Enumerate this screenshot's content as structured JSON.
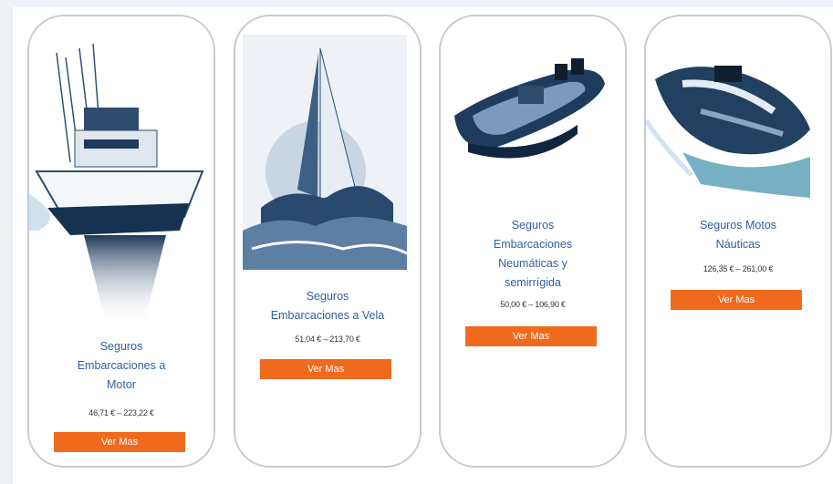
{
  "colors": {
    "accent": "#f06a1d",
    "title": "#2f5f9e",
    "background": "#eef1f6"
  },
  "products": [
    {
      "title_lines": [
        "Seguros",
        "Embarcaciones a",
        "Motor"
      ],
      "price": "46,71 € – 223,22 €",
      "button": "Ver Mas",
      "image": "motor-yacht-icon"
    },
    {
      "title_lines": [
        "Seguros",
        "Embarcaciones a Vela"
      ],
      "price": "51,04 € – 213,70 €",
      "button": "Ver Mas",
      "image": "sailboat-icon"
    },
    {
      "title_lines": [
        "Seguros",
        "Embarcaciones",
        "Neumáticas y",
        "semirrígida"
      ],
      "price": "50,00 € – 106,90 €",
      "button": "Ver Mas",
      "image": "rib-boat-icon"
    },
    {
      "title_lines": [
        "Seguros Motos",
        "Náuticas"
      ],
      "price": "126,35 € – 261,00 €",
      "button": "Ver Mas",
      "image": "jet-ski-icon"
    }
  ]
}
